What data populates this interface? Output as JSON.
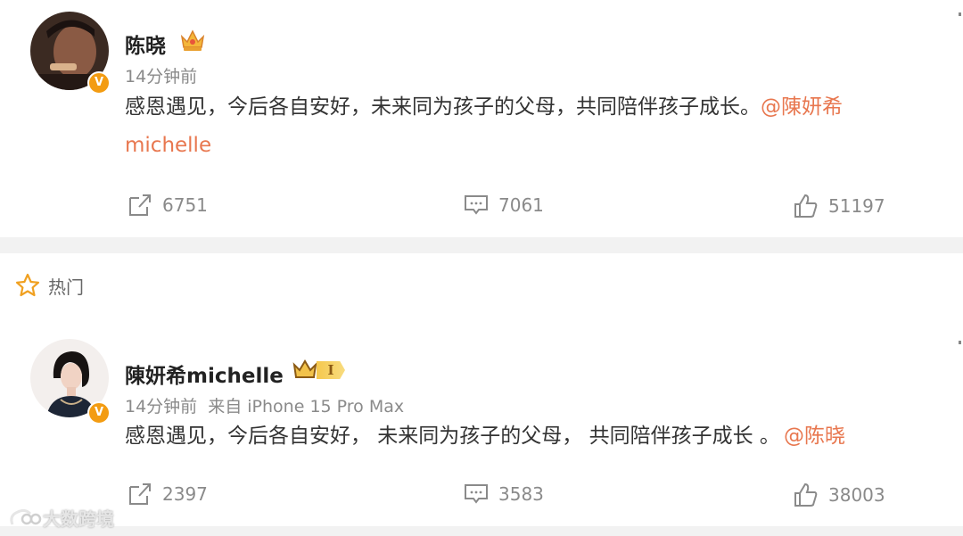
{
  "post1": {
    "author": "陈晓",
    "verified_badge": "V",
    "time": "14分钟前",
    "text": "感恩遇见，今后各自安好，未来同为孩子的父母，共同陪伴孩子成长。",
    "mention_line1": "@陳妍希",
    "mention_line2": "michelle",
    "reposts": "6751",
    "comments": "7061",
    "likes": "51197"
  },
  "hot_label": "热门",
  "post2": {
    "author": "陳妍希michelle",
    "verified_badge": "V",
    "level_badge": "I",
    "time": "14分钟前",
    "source": "来自 iPhone 15 Pro Max",
    "text": "感恩遇见，今后各自安好， 未来同为孩子的父母， 共同陪伴孩子成长 。",
    "mention": "@陈晓",
    "reposts": "2397",
    "comments": "3583",
    "likes": "38003"
  },
  "watermark": "大数跨境",
  "colors": {
    "mention": "#e8774f",
    "badge": "#f39c12",
    "separator": "#f2f2f2"
  }
}
